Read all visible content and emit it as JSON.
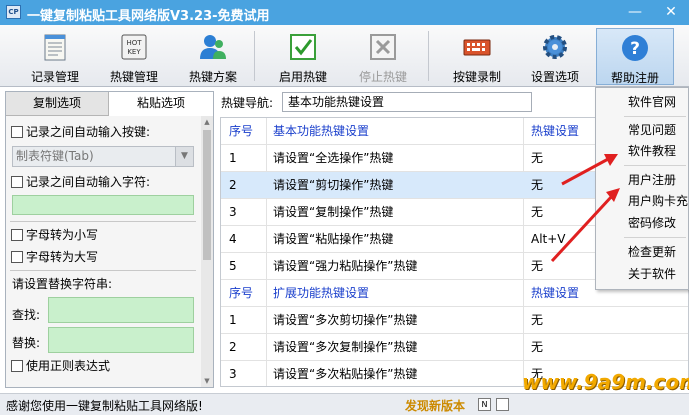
{
  "window": {
    "title": "一键复制粘贴工具网络版V3.23-免费试用",
    "app_icon_text": "CP",
    "minimize": "—",
    "close": "✕"
  },
  "toolbar": {
    "items": [
      {
        "label": "记录管理",
        "icon": "notepad-icon"
      },
      {
        "label": "热键管理",
        "icon": "hotkey-icon"
      },
      {
        "label": "热键方案",
        "icon": "users-icon"
      },
      {
        "label": "启用热键",
        "icon": "checkmark-icon"
      },
      {
        "label": "停止热键",
        "icon": "stop-x-icon",
        "disabled": true
      },
      {
        "label": "按键录制",
        "icon": "keyboard-icon"
      },
      {
        "label": "设置选项",
        "icon": "gear-icon"
      },
      {
        "label": "帮助注册",
        "icon": "help-icon",
        "active": true
      }
    ]
  },
  "left_panel": {
    "tabs": [
      "复制选项",
      "粘贴选项"
    ],
    "auto_key_label": "记录之间自动输入按键:",
    "auto_key_value": "制表符键(Tab)",
    "auto_char_label": "记录之间自动输入字符:",
    "lowercase_label": "字母转为小写",
    "uppercase_label": "字母转为大写",
    "replace_heading": "请设置替换字符串:",
    "find_label": "查找:",
    "replace_label": "替换:",
    "regex_label": "使用正则表达式"
  },
  "right_panel": {
    "nav_label": "热键导航:",
    "nav_value": "基本功能热键设置",
    "rows": [
      {
        "c1": "序号",
        "c2": "基本功能热键设置",
        "c3": "热键设置",
        "header": true
      },
      {
        "c1": "1",
        "c2": "请设置“全选操作”热键",
        "c3": "无"
      },
      {
        "c1": "2",
        "c2": "请设置“剪切操作”热键",
        "c3": "无",
        "selected": true
      },
      {
        "c1": "3",
        "c2": "请设置“复制操作”热键",
        "c3": "无"
      },
      {
        "c1": "4",
        "c2": "请设置“粘贴操作”热键",
        "c3": "Alt+V"
      },
      {
        "c1": "5",
        "c2": "请设置“强力粘贴操作”热键",
        "c3": "无"
      },
      {
        "c1": "序号",
        "c2": "扩展功能热键设置",
        "c3": "热键设置",
        "header": true
      },
      {
        "c1": "1",
        "c2": "请设置“多次剪切操作”热键",
        "c3": "无"
      },
      {
        "c1": "2",
        "c2": "请设置“多次复制操作”热键",
        "c3": "无"
      },
      {
        "c1": "3",
        "c2": "请设置“多次粘贴操作”热键",
        "c3": "无"
      }
    ]
  },
  "help_menu": {
    "items": [
      "软件官网",
      "常见问题",
      "软件教程",
      "用户注册",
      "用户购卡充",
      "密码修改",
      "检查更新",
      "关于软件"
    ]
  },
  "statusbar": {
    "message": "感谢您使用一键复制粘贴工具网络版!",
    "update": "发现新版本",
    "icon_text": "N"
  },
  "watermark": "www.9a9m.com",
  "colors": {
    "titlebar": "#4aa3e0",
    "header_text": "#1a3fcc",
    "selected_row": "#d7e9fb",
    "green_field": "#c9f0cc",
    "arrow_red": "#e02020",
    "update_text": "#cc8a00"
  }
}
